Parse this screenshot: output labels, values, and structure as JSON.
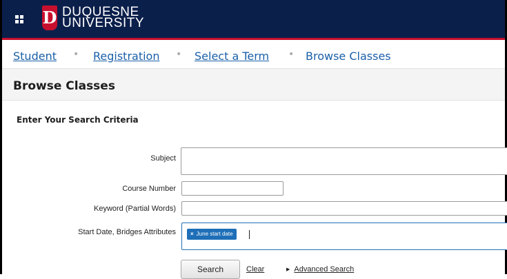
{
  "header": {
    "logo_line1": "DUQUESNE",
    "logo_line2": "UNIVERSITY",
    "logo_mark": "D",
    "menu_icon": "grid-icon",
    "colors": {
      "navy": "#0b1f4b",
      "red": "#c8102e"
    }
  },
  "breadcrumb": {
    "items": [
      "Student",
      "Registration",
      "Select a Term",
      "Browse Classes"
    ],
    "separator": "•"
  },
  "page": {
    "title": "Browse Classes"
  },
  "form": {
    "heading": "Enter Your Search Criteria",
    "subject_label": "Subject",
    "subject_value": "",
    "course_number_label": "Course Number",
    "course_number_value": "",
    "keyword_label": "Keyword (Partial Words)",
    "keyword_value": "",
    "attributes_label": "Start Date, Bridges Attributes",
    "attributes_chip": "June start date",
    "attributes_chip_remove": "×"
  },
  "actions": {
    "search_label": "Search",
    "clear_label": "Clear",
    "advanced_label": "Advanced Search",
    "advanced_icon": "triangle-right-icon"
  }
}
